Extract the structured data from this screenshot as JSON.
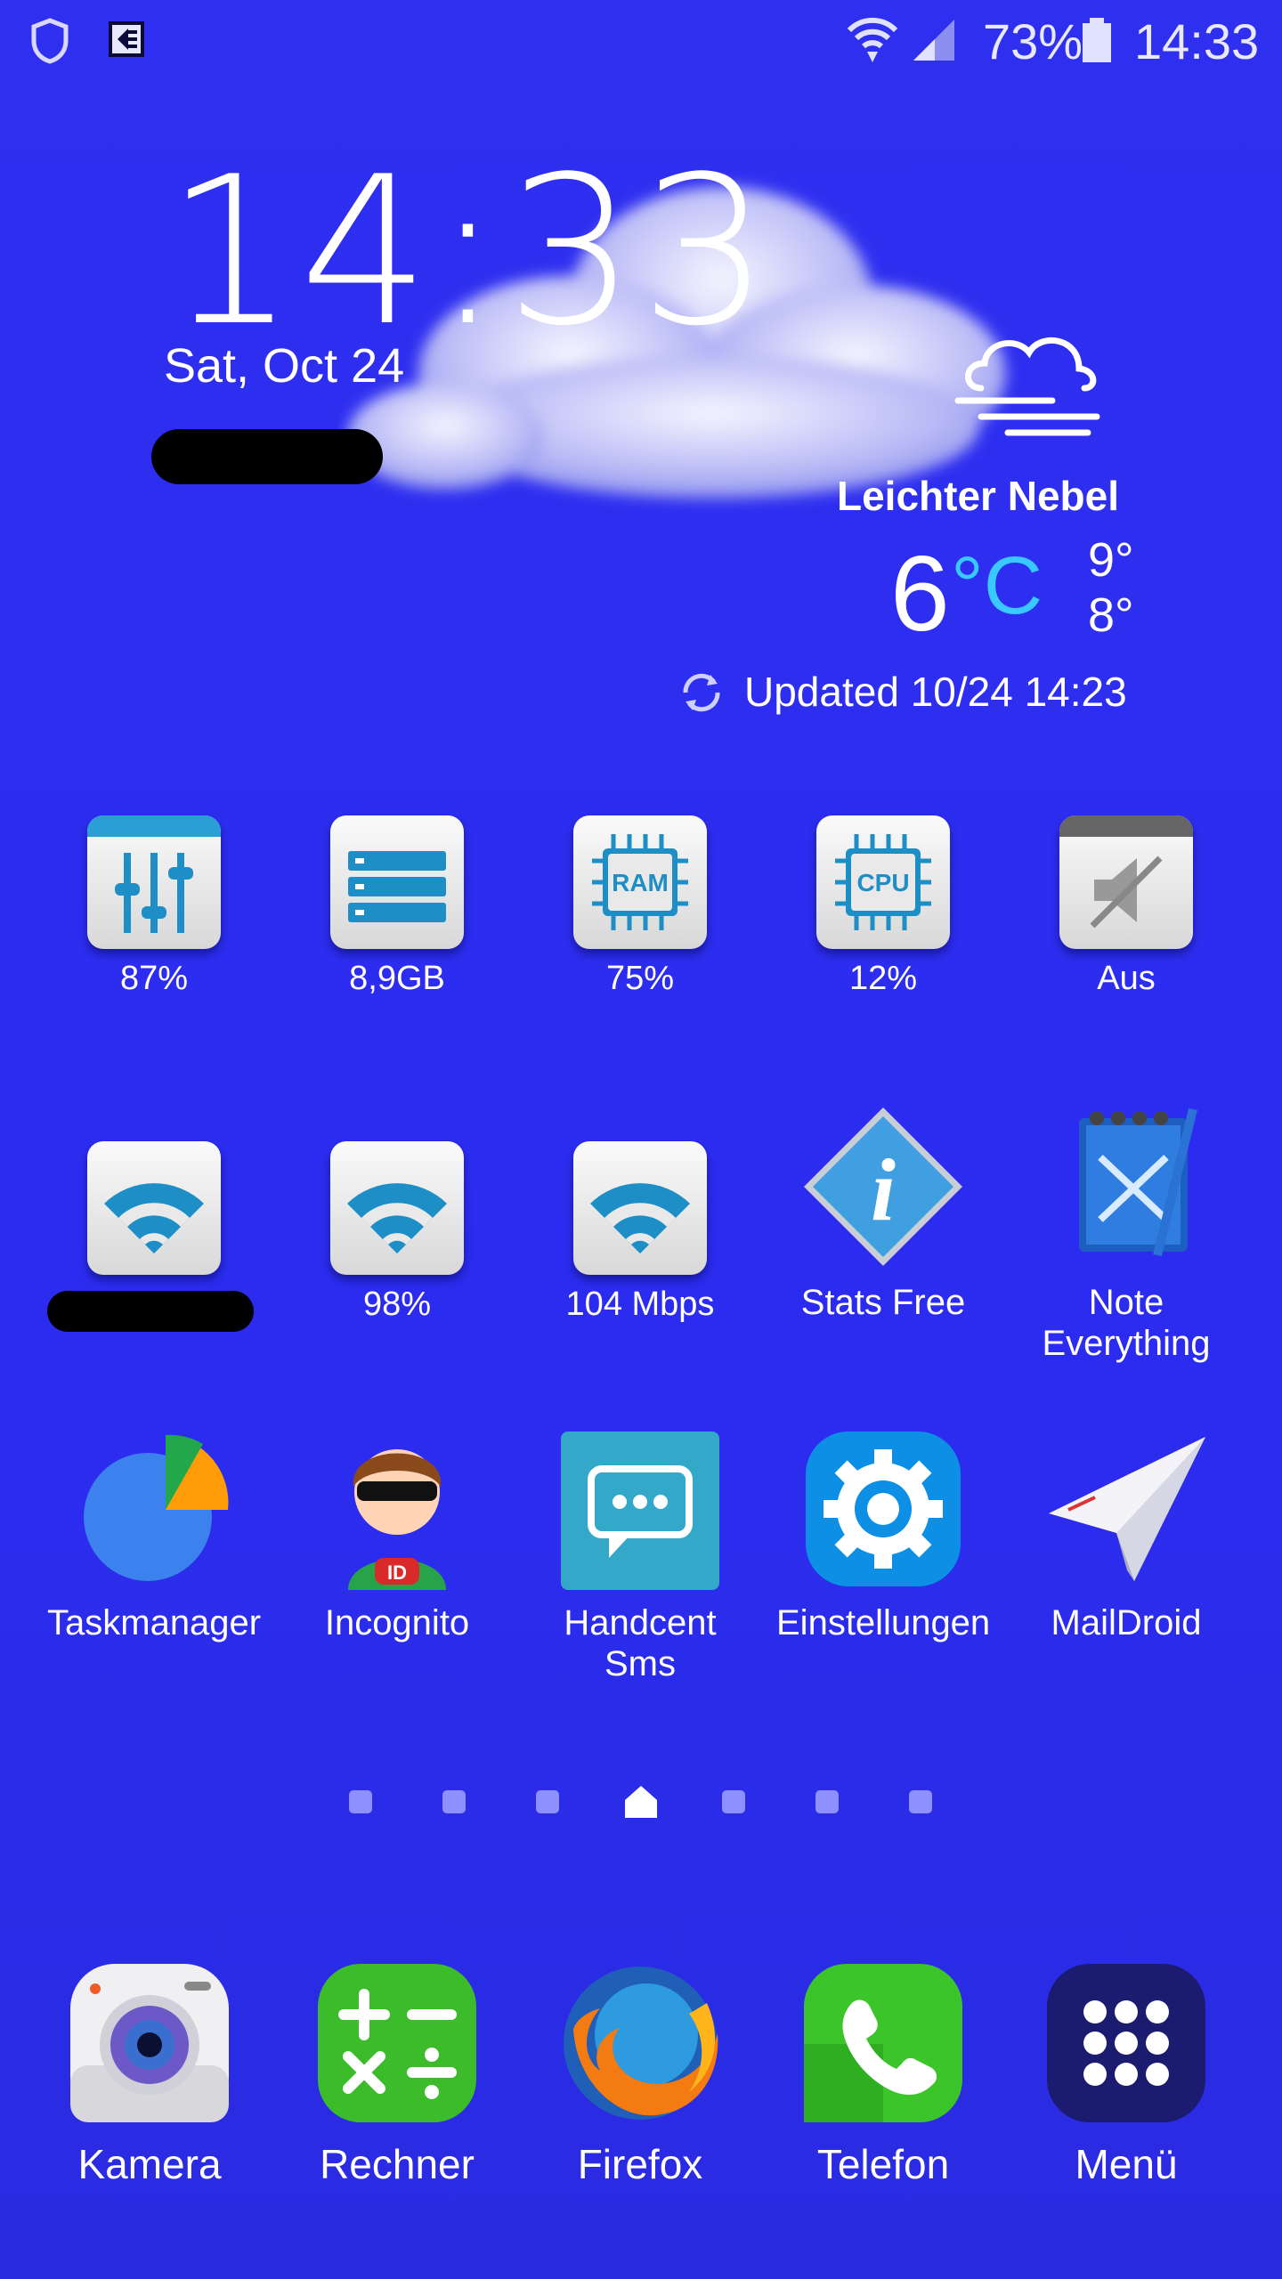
{
  "status_bar": {
    "battery": "73%",
    "time": "14:33"
  },
  "clock": {
    "time": "14:33",
    "date": "Sat, Oct 24"
  },
  "weather": {
    "condition": "Leichter Nebel",
    "temp": "6",
    "unit": "°C",
    "high": "9°",
    "low": "8°",
    "updated": "Updated 10/24 14:23"
  },
  "row1": [
    {
      "label": "87%",
      "icon": "sliders-icon"
    },
    {
      "label": "8,9GB",
      "icon": "storage-icon"
    },
    {
      "label": "75%",
      "icon": "ram-icon"
    },
    {
      "label": "12%",
      "icon": "cpu-icon"
    },
    {
      "label": "Aus",
      "icon": "mute-icon"
    }
  ],
  "row2": [
    {
      "label": "",
      "icon": "wifi-icon"
    },
    {
      "label": "98%",
      "icon": "wifi-icon"
    },
    {
      "label": "104 Mbps",
      "icon": "wifi-icon"
    },
    {
      "label": "Stats Free",
      "icon": "info-diamond-icon"
    },
    {
      "label": "Note Everything",
      "icon": "notepad-icon"
    }
  ],
  "row3": [
    {
      "label": "Taskmanager",
      "icon": "pie-chart-icon"
    },
    {
      "label": "Incognito",
      "icon": "incognito-icon"
    },
    {
      "label": "Handcent Sms",
      "icon": "chat-bubble-icon"
    },
    {
      "label": "Einstellungen",
      "icon": "gear-icon"
    },
    {
      "label": "MailDroid",
      "icon": "paper-plane-icon"
    }
  ],
  "dock": [
    {
      "label": "Kamera",
      "icon": "camera-icon"
    },
    {
      "label": "Rechner",
      "icon": "calculator-icon"
    },
    {
      "label": "Firefox",
      "icon": "firefox-icon"
    },
    {
      "label": "Telefon",
      "icon": "phone-icon"
    },
    {
      "label": "Menü",
      "icon": "apps-grid-icon"
    }
  ],
  "page_indicator": {
    "pages": 7,
    "current_home_index": 3
  },
  "colors": {
    "background": "#2f2ff0",
    "accent_cyan": "#39c8ff",
    "tile_blue": "#1e8fc6"
  }
}
